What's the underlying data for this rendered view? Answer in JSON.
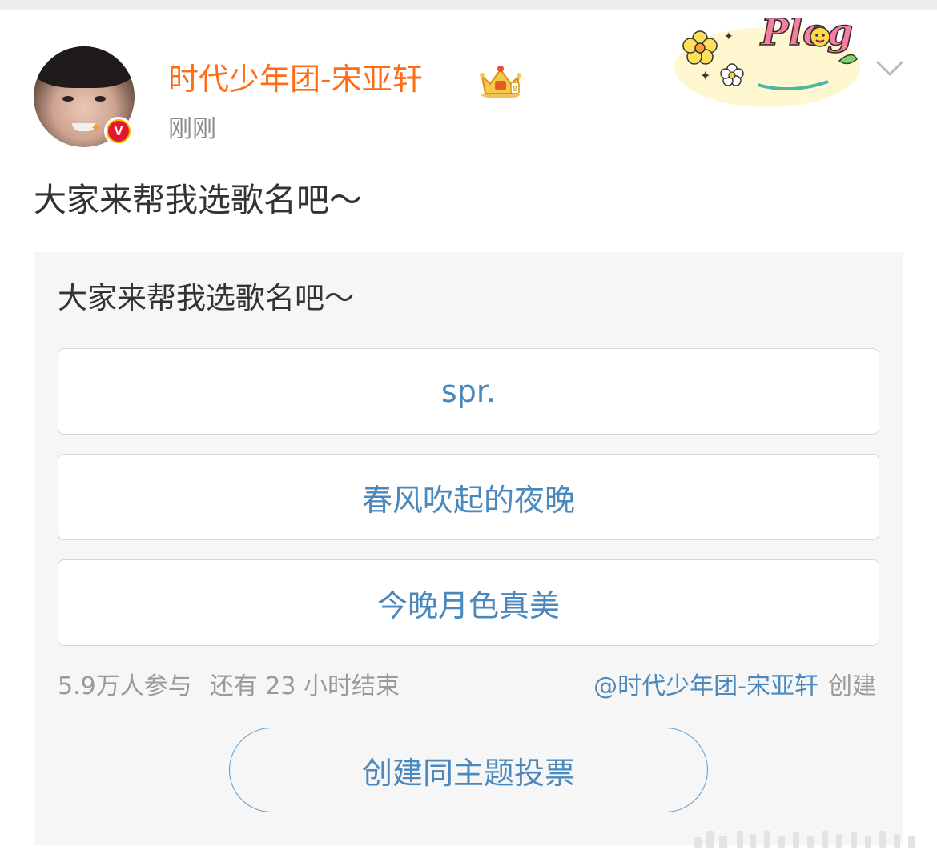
{
  "post": {
    "author_name": "时代少年团-宋亚轩",
    "timestamp": "刚刚",
    "text": "大家来帮我选歌名吧～",
    "sticker_text": "Plog"
  },
  "poll": {
    "title": "大家来帮我选歌名吧～",
    "options": [
      {
        "label": "spr."
      },
      {
        "label": "春风吹起的夜晚"
      },
      {
        "label": "今晚月色真美"
      }
    ],
    "participants": "5.9万人参与",
    "remaining": "还有 23 小时结束",
    "creator": "@时代少年团-宋亚轩",
    "creator_action": "创建",
    "create_same_topic": "创建同主题投票"
  },
  "icons": {
    "verified_badge": "verified-v-icon",
    "crown": "crown-icon",
    "menu": "chevron-down-icon"
  },
  "colors": {
    "name": "#ff6c16",
    "link": "#4a88bd",
    "muted": "#9a9a9a",
    "card_bg": "#f6f6f6"
  }
}
